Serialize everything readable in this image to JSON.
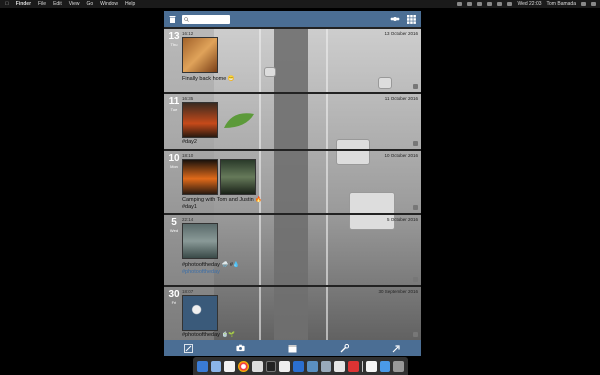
{
  "menubar": {
    "app_name": "Finder",
    "menus": [
      "File",
      "Edit",
      "View",
      "Go",
      "Window",
      "Help"
    ],
    "clock": "Wed 22:03",
    "user": "Tom Bamada"
  },
  "entries": [
    {
      "day": "13",
      "weekday": "Thu",
      "time": "16:12",
      "date": "13 October 2016",
      "caption": "Finally back home 😁",
      "hashtags": ""
    },
    {
      "day": "11",
      "weekday": "Tue",
      "time": "16:35",
      "date": "11 October 2016",
      "caption": "#day2",
      "hashtags": ""
    },
    {
      "day": "10",
      "weekday": "Mon",
      "time": "18:10",
      "date": "10 October 2016",
      "caption": "Camping with Tom and Justin 🔥",
      "hashtags": "#day1"
    },
    {
      "day": "5",
      "weekday": "Wed",
      "time": "22:14",
      "date": "5 October 2016",
      "caption": "#photooftheday 🌧️ #💧",
      "hashtags": "#photooftheday"
    },
    {
      "day": "30",
      "weekday": "Fri",
      "time": "18:07",
      "date": "30 September 2016",
      "caption": "#photooftheday 🍵🌱",
      "hashtags": ""
    }
  ],
  "colors": {
    "bar": "#4b6e94",
    "hashtag": "#3b6ea8"
  }
}
